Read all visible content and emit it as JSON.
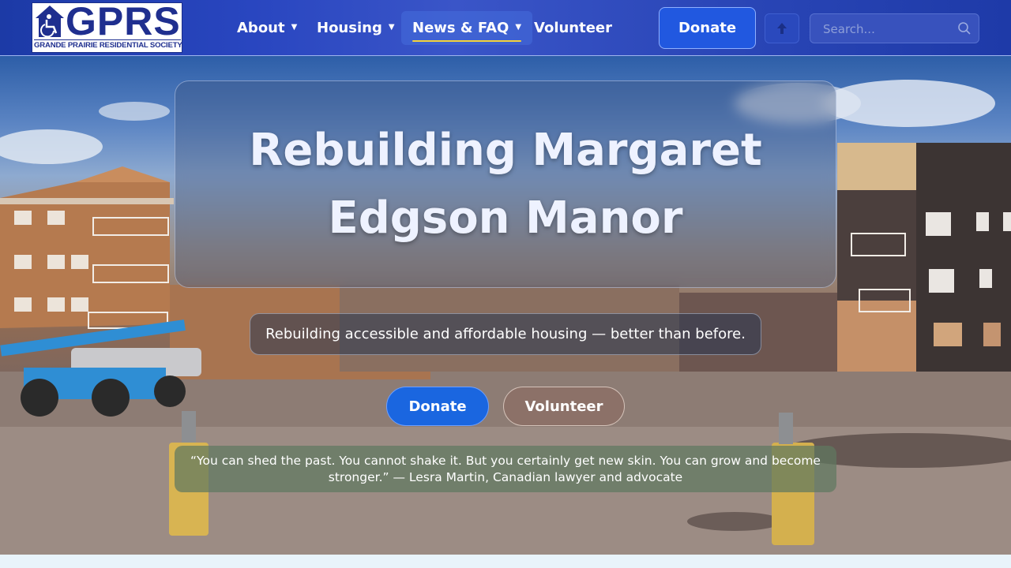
{
  "header": {
    "logo": {
      "brand": "GPRS",
      "tagline": "GRANDE PRAIRIE RESIDENTIAL SOCIETY"
    },
    "nav": [
      {
        "label": "About",
        "has_dropdown": true
      },
      {
        "label": "Housing",
        "has_dropdown": true
      },
      {
        "label": "News & FAQ",
        "has_dropdown": true,
        "active": true
      },
      {
        "label": "Volunteer",
        "has_dropdown": false
      }
    ],
    "donate_label": "Donate",
    "up_icon": "arrow-up-icon",
    "search": {
      "placeholder": "Search...",
      "value": "",
      "icon": "search-icon"
    }
  },
  "hero": {
    "title": "Rebuilding Margaret Edgson Manor",
    "subtitle": "Rebuilding accessible and affordable housing — better than before.",
    "buttons": {
      "donate": "Donate",
      "volunteer": "Volunteer"
    },
    "quote": "“You can shed the past. You cannot shake it. But you certainly get new skin. You can grow and become stronger.” — Lesra Martin, Canadian lawyer and advocate"
  },
  "colors": {
    "header_blue": "#1c3aa6",
    "donate_blue": "#1a66e0",
    "active_underline": "#f4d23a",
    "quote_bg": "#5f785f"
  }
}
